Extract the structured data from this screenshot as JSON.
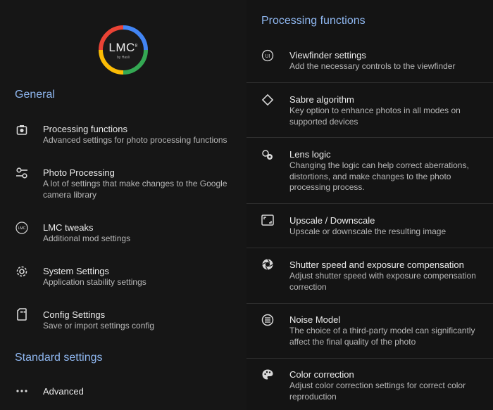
{
  "left": {
    "logo": {
      "text": "LMC",
      "superscript": "8",
      "subtext": "by Hasli"
    },
    "general_title": "General",
    "items": [
      {
        "icon": "camera-icon",
        "title": "Processing functions",
        "desc": "Advanced settings for photo processing functions"
      },
      {
        "icon": "tune-icon",
        "title": "Photo Processing",
        "desc": "A lot of settings that make changes to the Google camera library"
      },
      {
        "icon": "lmc-badge-icon",
        "title": "LMC tweaks",
        "desc": "Additional mod settings"
      },
      {
        "icon": "gear-icon",
        "title": "System Settings",
        "desc": "Application stability settings"
      },
      {
        "icon": "sd-card-icon",
        "title": "Config Settings",
        "desc": "Save or import settings config"
      }
    ],
    "standard_title": "Standard settings",
    "advanced": {
      "icon": "more-horizontal-icon",
      "title": "Advanced"
    }
  },
  "right": {
    "title": "Processing functions",
    "items": [
      {
        "icon": "viewfinder-ui-icon",
        "title": "Viewfinder settings",
        "desc": "Add the necessary controls to the viewfinder"
      },
      {
        "icon": "diamond-icon",
        "title": "Sabre algorithm",
        "desc": "Key option to enhance photos in all modes on supported devices"
      },
      {
        "icon": "lens-icon",
        "title": "Lens logic",
        "desc": "Changing the logic can help correct aberrations, distortions, and make changes to the photo processing process."
      },
      {
        "icon": "resize-icon",
        "title": "Upscale / Downscale",
        "desc": "Upscale or downscale the resulting image"
      },
      {
        "icon": "shutter-icon",
        "title": "Shutter speed and exposure compensation",
        "desc": "Adjust shutter speed with exposure compensation correction"
      },
      {
        "icon": "noise-list-icon",
        "title": "Noise Model",
        "desc": "The choice of a third-party model can significantly affect the final quality of the photo"
      },
      {
        "icon": "palette-icon",
        "title": "Color correction",
        "desc": "Adjust color correction settings for correct color reproduction"
      }
    ]
  },
  "colors": {
    "accent": "#8fb7f0",
    "background": "#161616",
    "divider": "#2e2e2e"
  }
}
